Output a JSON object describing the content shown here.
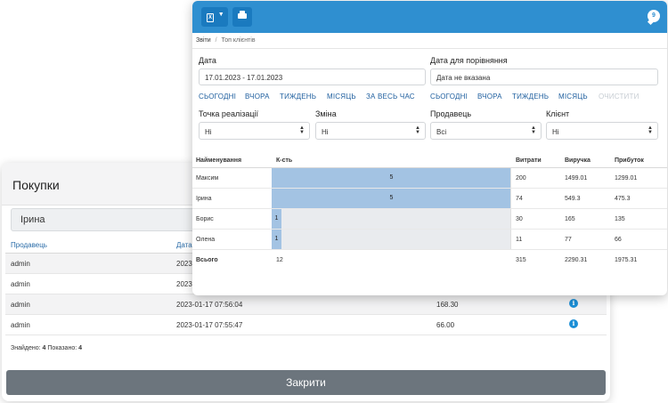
{
  "purchases": {
    "title": "Покупки",
    "search_value": "Ірина",
    "columns": [
      "Продавець",
      "Дата"
    ],
    "rows": [
      {
        "seller": "admin",
        "date": "2023",
        "amount": ""
      },
      {
        "seller": "admin",
        "date": "2023",
        "amount": ""
      },
      {
        "seller": "admin",
        "date": "2023-01-17 07:56:04",
        "amount": "168.30"
      },
      {
        "seller": "admin",
        "date": "2023-01-17 07:55:47",
        "amount": "66.00"
      }
    ],
    "footer": {
      "found_label": "Знайдено:",
      "found": "4",
      "shown_label": "Показано:",
      "shown": "4"
    },
    "close_label": "Закрити"
  },
  "report": {
    "toolbar": {
      "excel_icon_text": "X",
      "chat_icon_text": "9"
    },
    "breadcrumb": {
      "root": "Звіти",
      "separator": "/",
      "current": "Топ клієнтів"
    },
    "date": {
      "label": "Дата",
      "value": "17.01.2023 - 17.01.2023"
    },
    "compare_date": {
      "label": "Дата для порівняння",
      "value": "Дата не вказана"
    },
    "quick_left": [
      "СЬОГОДНІ",
      "ВЧОРА",
      "ТИЖДЕНЬ",
      "МІСЯЦЬ",
      "ЗА ВЕСЬ ЧАС"
    ],
    "quick_right": [
      "СЬОГОДНІ",
      "ВЧОРА",
      "ТИЖДЕНЬ",
      "МІСЯЦЬ"
    ],
    "clear_label": "ОЧИСТИТИ",
    "filters": [
      {
        "label": "Точка реалізації",
        "value": "Ні"
      },
      {
        "label": "Зміна",
        "value": "Ні"
      },
      {
        "label": "Продавець",
        "value": "Всі"
      },
      {
        "label": "Клієнт",
        "value": "Ні"
      }
    ],
    "columns": {
      "name": "Найменування",
      "qty": "К-сть",
      "cost": "Витрати",
      "revenue": "Виручка",
      "profit": "Прибуток"
    },
    "rows": [
      {
        "name": "Максим",
        "qty": 5,
        "cost": "200",
        "revenue": "1499.01",
        "profit": "1299.01"
      },
      {
        "name": "Ірина",
        "qty": 5,
        "cost": "74",
        "revenue": "549.3",
        "profit": "475.3"
      },
      {
        "name": "Борис",
        "qty": 1,
        "cost": "30",
        "revenue": "165",
        "profit": "135"
      },
      {
        "name": "Олена",
        "qty": 1,
        "cost": "11",
        "revenue": "77",
        "profit": "66"
      }
    ],
    "total": {
      "name": "Всього",
      "qty": "12",
      "cost": "315",
      "revenue": "2290.31",
      "profit": "1975.31"
    },
    "max_qty": 5
  }
}
